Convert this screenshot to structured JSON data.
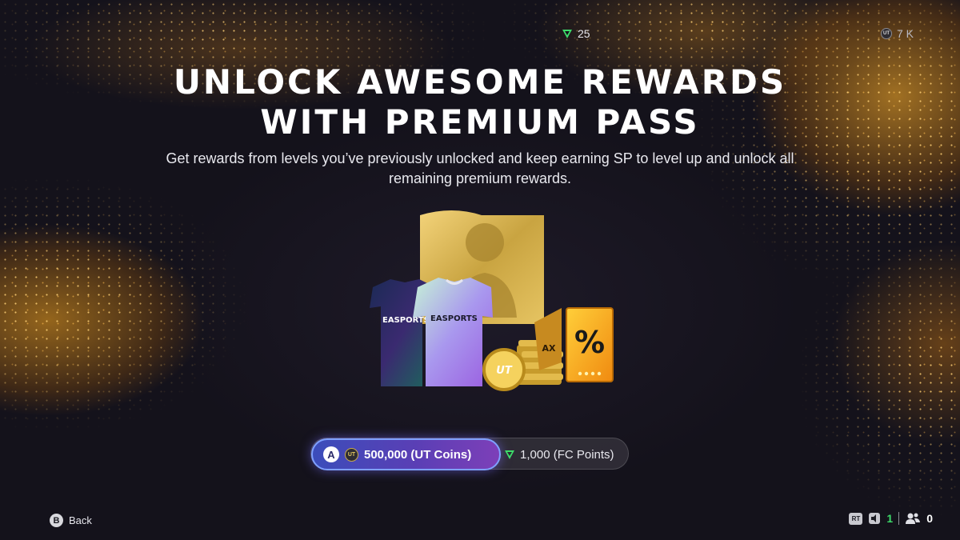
{
  "header": {
    "fc_points_balance": "25",
    "coins_balance": "7 K"
  },
  "hero": {
    "title_line1": "UNLOCK AWESOME REWARDS",
    "title_line2": "WITH PREMIUM PASS",
    "subtitle": "Get rewards from levels you’ve previously unlocked and keep earning SP to level up and unlock all remaining premium rewards."
  },
  "art": {
    "kit_brand": "EASPORTS",
    "coins_logo": "UT",
    "percent_symbol": "%",
    "gold_tag_text": "AX"
  },
  "purchase": {
    "coins_button_key": "A",
    "coins_option_label": "500,000 (UT Coins)",
    "fc_option_label": "1,000 (FC Points)"
  },
  "footer": {
    "back_key": "B",
    "back_label": "Back",
    "rt_label": "RT",
    "mic_count": "1",
    "party_count": "0"
  },
  "colors": {
    "background": "#14121b",
    "accent_gold": "#f0a020",
    "selected_gradient_start": "#3b4dba",
    "selected_gradient_end": "#7d3fb8",
    "fc_icon_green": "#3ddc6a"
  }
}
